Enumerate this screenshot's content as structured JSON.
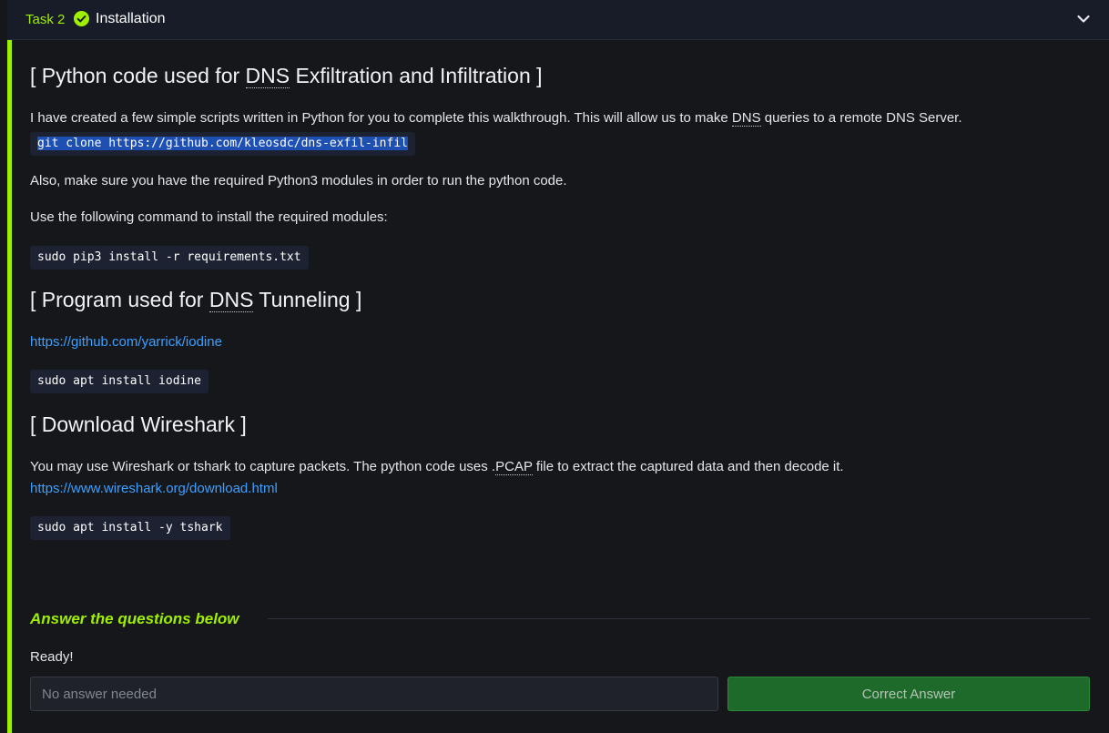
{
  "header": {
    "task_number": "Task 2",
    "task_title": "Installation",
    "status_icon": "check-circle-icon",
    "toggle_icon": "chevron-down-icon",
    "accent_color": "#9fef00"
  },
  "sections": {
    "python": {
      "heading_prefix": "[ Python code used for ",
      "heading_abbr": "DNS",
      "heading_suffix": " Exfiltration and Infiltration ]",
      "intro_prefix": "I have created a few simple scripts written in Python for you to complete this walkthrough. This will allow us to make ",
      "intro_abbr": "DNS",
      "intro_suffix": " queries to a remote DNS Server.",
      "clone_command": "git clone https://github.com/kleosdc/dns-exfil-infil",
      "modules_note": "Also, make sure you have the required Python3 modules in order to run the python code.",
      "install_note": "Use the following command to install the required modules:",
      "pip_command": "sudo pip3 install -r requirements.txt"
    },
    "tunneling": {
      "heading_prefix": "[ Program used for ",
      "heading_abbr": "DNS",
      "heading_suffix": " Tunneling ]",
      "link": "https://github.com/yarrick/iodine",
      "apt_command": "sudo apt install iodine"
    },
    "wireshark": {
      "heading": "[ Download Wireshark ]",
      "desc_prefix": "You may use Wireshark or tshark to capture packets. The python code uses .",
      "desc_abbr": "PCAP",
      "desc_suffix": " file to extract the captured data and then decode it.",
      "link": "https://www.wireshark.org/download.html",
      "apt_command": "sudo apt install -y tshark"
    }
  },
  "answers": {
    "heading": "Answer the questions below",
    "question": "Ready!",
    "placeholder": "No answer needed",
    "button_label": "Correct Answer",
    "button_color": "#1e6a2a"
  }
}
